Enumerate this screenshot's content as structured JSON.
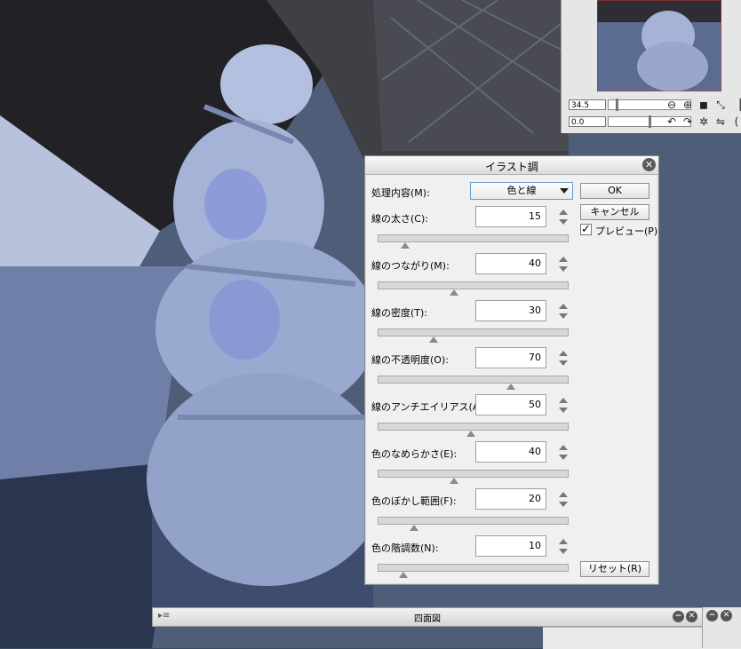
{
  "dialog": {
    "title": "イラスト調",
    "mode_label": "処理内容(M):",
    "mode_value": "色と線",
    "ok_label": "OK",
    "cancel_label": "キャンセル",
    "preview_label": "プレビュー(P)",
    "preview_checked": true,
    "reset_label": "リセット(R)",
    "params": [
      {
        "label": "線の太さ(C):",
        "value": "15",
        "slider_fraction": 0.14
      },
      {
        "label": "線のつながり(M):",
        "value": "40",
        "slider_fraction": 0.4
      },
      {
        "label": "線の密度(T):",
        "value": "30",
        "slider_fraction": 0.29
      },
      {
        "label": "線の不透明度(O):",
        "value": "70",
        "slider_fraction": 0.7
      },
      {
        "label": "線のアンチエイリアス(A):",
        "value": "50",
        "slider_fraction": 0.49
      },
      {
        "label": "色のなめらかさ(E):",
        "value": "40",
        "slider_fraction": 0.4
      },
      {
        "label": "色のぼかし範囲(F):",
        "value": "20",
        "slider_fraction": 0.19
      },
      {
        "label": "色の階調数(N):",
        "value": "10",
        "slider_fraction": 0.13
      }
    ]
  },
  "navigator": {
    "zoom_value": "34.5",
    "rotate_value": "0.0",
    "icons": [
      "zoom-out-icon",
      "zoom-in-icon",
      "fit-screen-icon",
      "fit-window-icon",
      "rotate-left-icon",
      "rotate-right-icon",
      "reset-rotation-icon",
      "flip-icon"
    ]
  },
  "bottom_panel": {
    "title": "四面図"
  },
  "colors": {
    "dialog_bg": "#f0f0f0",
    "canvas_tint": "#3a4a60",
    "select_border": "#6a9ad0"
  }
}
